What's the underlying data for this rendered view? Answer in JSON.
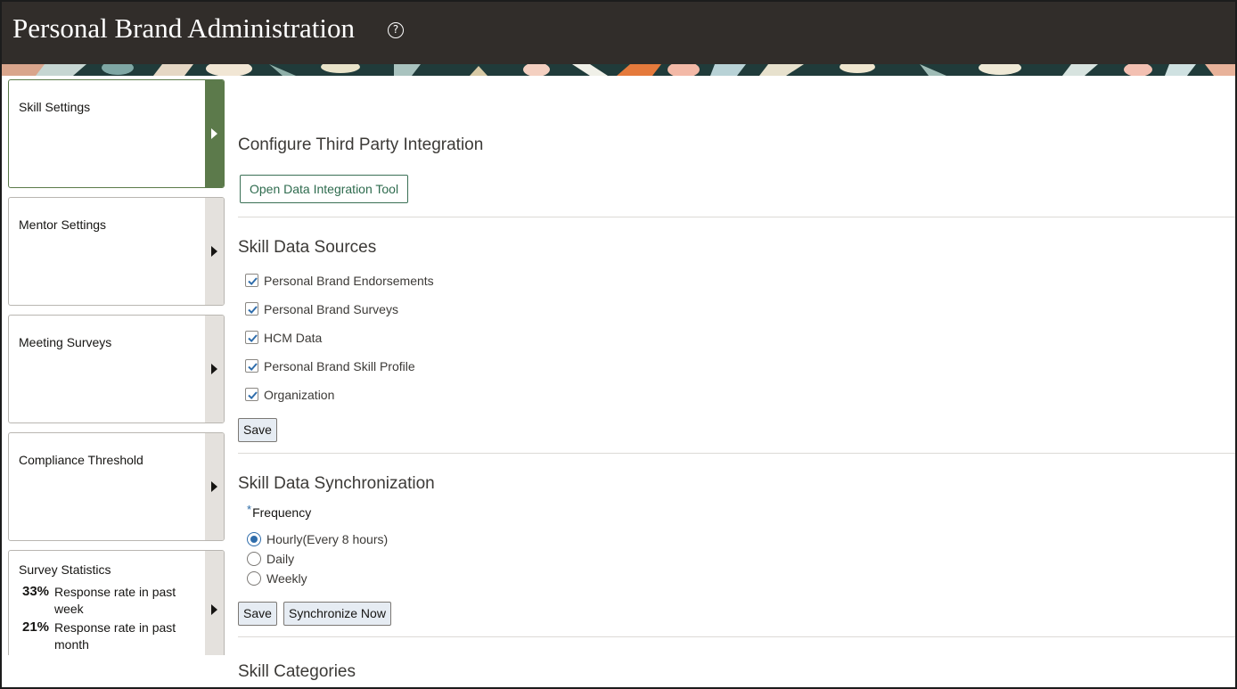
{
  "header": {
    "title": "Personal Brand Administration",
    "help_icon": "?"
  },
  "sidebar": {
    "cards": [
      {
        "label": "Skill Settings",
        "selected": true
      },
      {
        "label": "Mentor Settings",
        "selected": false
      },
      {
        "label": "Meeting Surveys",
        "selected": false
      },
      {
        "label": "Compliance Threshold",
        "selected": false
      },
      {
        "label": "Survey Statistics",
        "selected": false
      }
    ],
    "survey_stats": [
      {
        "value": "33%",
        "text": "Response rate in past week"
      },
      {
        "value": "21%",
        "text": "Response rate in past month"
      }
    ]
  },
  "main": {
    "third_party": {
      "title": "Configure Third Party Integration",
      "button_label": "Open Data Integration Tool"
    },
    "data_sources": {
      "title": "Skill Data Sources",
      "items": [
        {
          "label": "Personal Brand Endorsements",
          "checked": true
        },
        {
          "label": "Personal Brand Surveys",
          "checked": true
        },
        {
          "label": "HCM Data",
          "checked": true
        },
        {
          "label": "Personal Brand Skill Profile",
          "checked": true
        },
        {
          "label": "Organization",
          "checked": true
        }
      ],
      "save_label": "Save"
    },
    "sync": {
      "title": "Skill Data Synchronization",
      "required_marker": "*",
      "frequency_label": "Frequency",
      "options": [
        {
          "label": "Hourly(Every 8 hours)",
          "selected": true
        },
        {
          "label": "Daily",
          "selected": false
        },
        {
          "label": "Weekly",
          "selected": false
        }
      ],
      "save_label": "Save",
      "sync_now_label": "Synchronize Now"
    },
    "categories": {
      "title": "Skill Categories"
    }
  },
  "colors": {
    "header_bg": "#312d2a",
    "selected_strip": "#5c7a4b",
    "outline_button": "#2e6b4e",
    "checkbox_check": "#2f6dab",
    "button_bg": "#e6ecf3"
  }
}
